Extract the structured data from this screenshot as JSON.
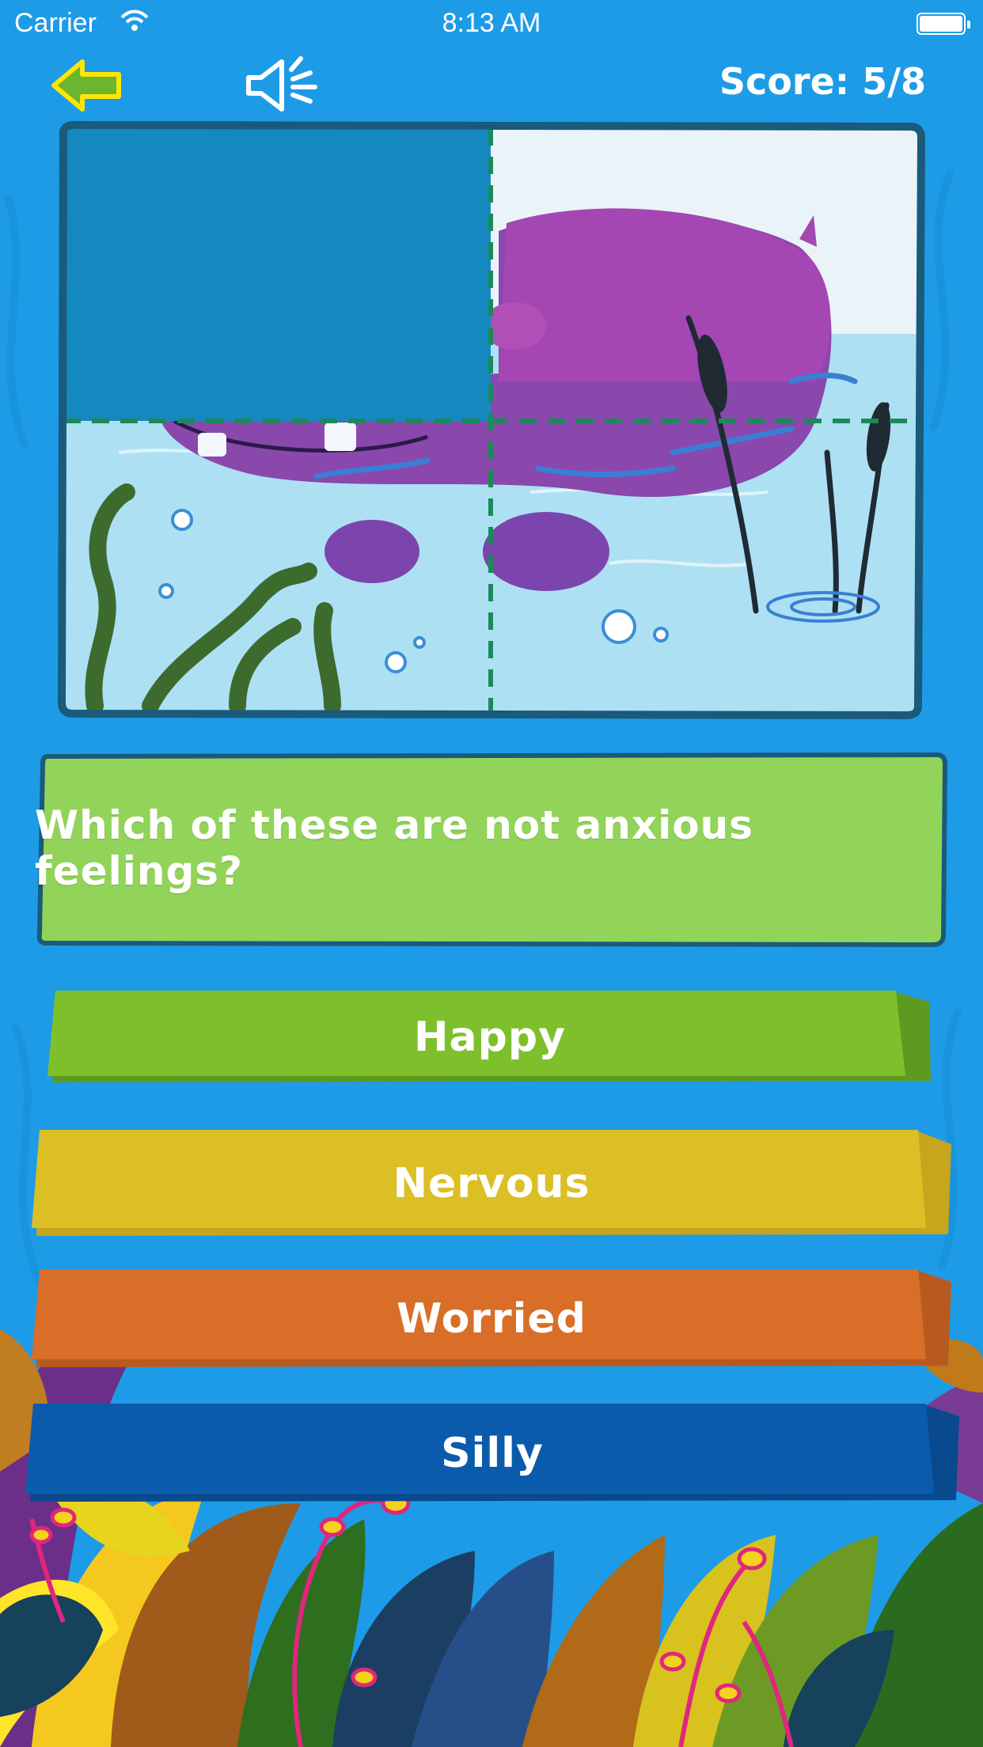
{
  "status_bar": {
    "carrier": "Carrier",
    "time": "8:13 AM"
  },
  "header": {
    "score": "Score: 5/8"
  },
  "puzzle": {
    "icon": "hippo-puzzle-image",
    "pieces_total": 4,
    "pieces_revealed": 3
  },
  "question": {
    "text": "Which of these are not anxious feelings?"
  },
  "answers": [
    {
      "label": "Happy",
      "color": "#7ec02c"
    },
    {
      "label": "Nervous",
      "color": "#dcbf24"
    },
    {
      "label": "Worried",
      "color": "#d86e27"
    },
    {
      "label": "Silly",
      "color": "#0b5bad"
    }
  ],
  "colors": {
    "background": "#1e9be6",
    "question_card": "#92d35a",
    "outline": "#1a5a7a"
  }
}
